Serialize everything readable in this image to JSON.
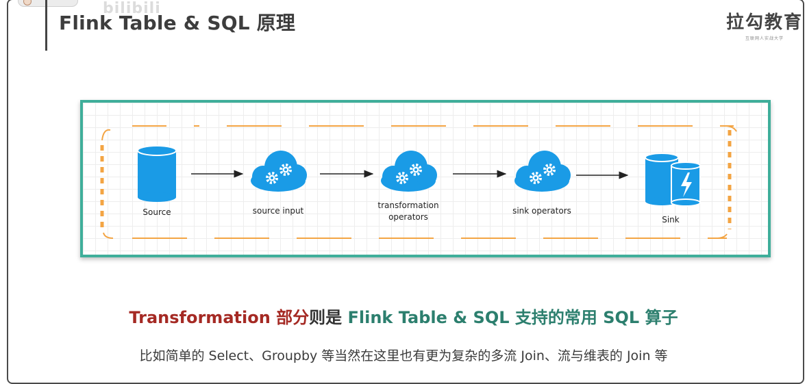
{
  "header": {
    "title": "Flink Table & SQL 原理",
    "logo_text": "拉勾教育",
    "logo_sub": "互联网人实战大学",
    "watermark": "bilibili"
  },
  "diagram": {
    "nodes": [
      {
        "label_lines": [
          "Source"
        ],
        "icon": "database-cylinder-icon"
      },
      {
        "label_lines": [
          "source input"
        ],
        "icon": "cloud-gears-icon"
      },
      {
        "label_lines": [
          "transformation",
          "operators"
        ],
        "icon": "cloud-gears-icon"
      },
      {
        "label_lines": [
          "sink operators"
        ],
        "icon": "cloud-gears-icon"
      },
      {
        "label_lines": [
          "Sink"
        ],
        "icon": "database-lightning-icon"
      }
    ],
    "colors": {
      "border": "#3fae9a",
      "icon": "#1a9be6",
      "dashes": "#f3a443"
    }
  },
  "caption": {
    "part1": "Transformation 部分",
    "part2": "则是 ",
    "part3": "Flink Table & SQL 支持的常用 SQL 算子"
  },
  "subcaption": "比如简单的 Select、Groupby 等当然在这里也有更为复杂的多流 Join、流与维表的 Join 等"
}
